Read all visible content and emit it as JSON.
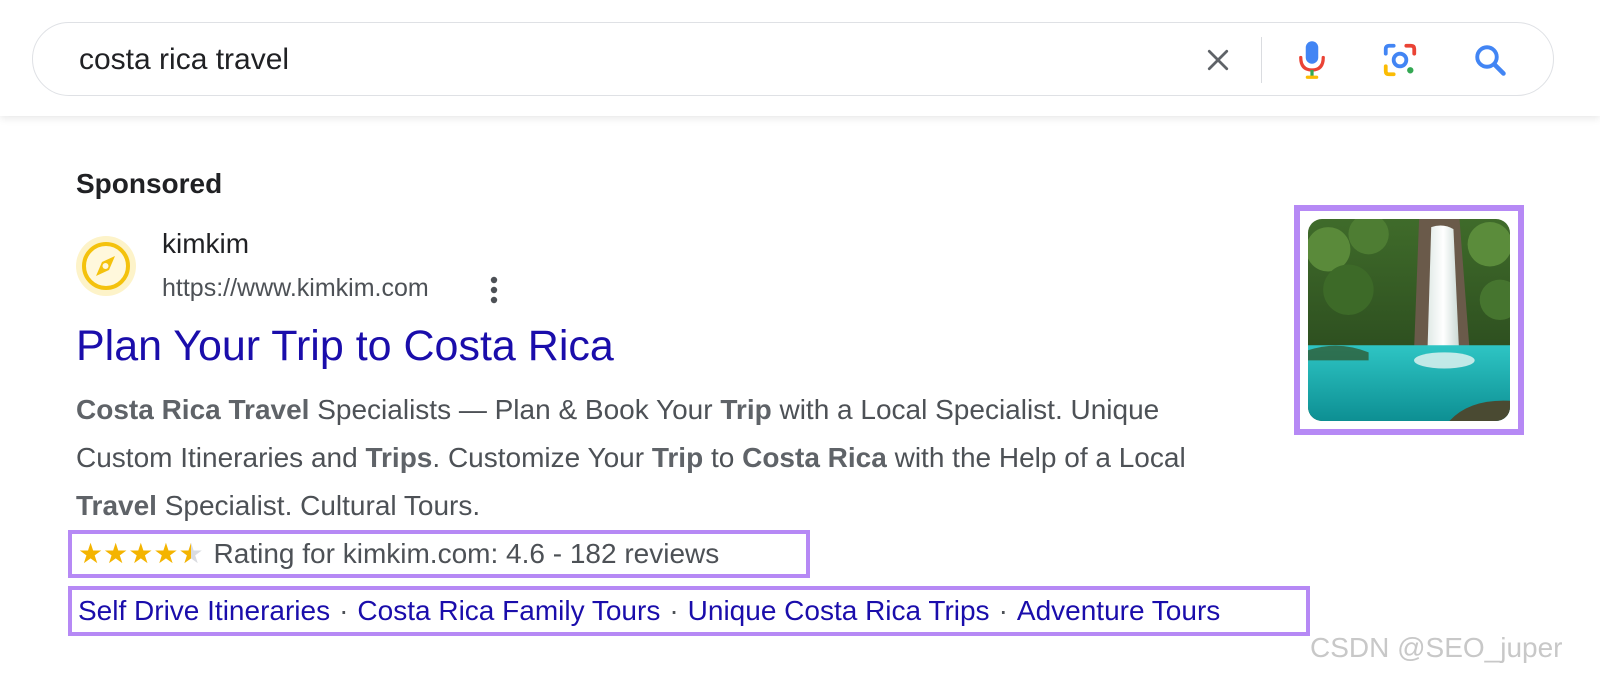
{
  "search": {
    "query": "costa rica travel",
    "clear_icon": "close-icon",
    "mic_icon": "microphone-icon",
    "lens_icon": "camera-lens-icon",
    "search_icon": "search-icon"
  },
  "result": {
    "sponsored_label": "Sponsored",
    "site_name": "kimkim",
    "site_url": "https://www.kimkim.com",
    "favicon_icon": "compass-icon",
    "more_icon": "more-vert-icon",
    "title": "Plan Your Trip to Costa Rica",
    "description": [
      {
        "text": "Costa Rica Travel",
        "bold": true
      },
      {
        "text": " Specialists — Plan & Book Your ",
        "bold": false
      },
      {
        "text": "Trip",
        "bold": true
      },
      {
        "text": " with a Local Specialist. Unique Custom Itineraries and ",
        "bold": false
      },
      {
        "text": "Trips",
        "bold": true
      },
      {
        "text": ". Customize Your ",
        "bold": false
      },
      {
        "text": "Trip",
        "bold": true
      },
      {
        "text": " to ",
        "bold": false
      },
      {
        "text": "Costa Rica",
        "bold": true
      },
      {
        "text": " with the Help of a Local ",
        "bold": false
      },
      {
        "text": "Travel",
        "bold": true
      },
      {
        "text": " Specialist. Cultural Tours.",
        "bold": false
      }
    ],
    "rating": {
      "value": 4.6,
      "max": 5,
      "text": "Rating for kimkim.com: 4.6 - 182 reviews"
    },
    "sitelinks": [
      "Self Drive Itineraries",
      "Costa Rica Family Tours",
      "Unique Costa Rica Trips",
      "Adventure Tours"
    ],
    "sitelink_separator": "·",
    "image_subject": "waterfall-thumbnail"
  },
  "colors": {
    "link": "#1a0dab",
    "highlight_border": "#b689f5",
    "star": "#f4b400"
  },
  "watermark": "CSDN @SEO_juper"
}
